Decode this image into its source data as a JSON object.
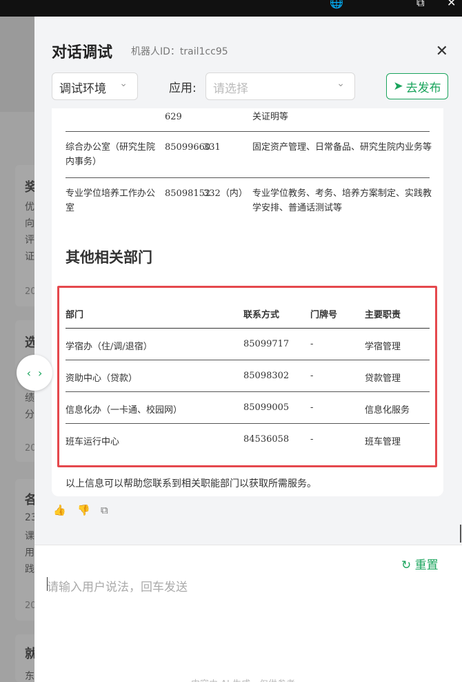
{
  "topbar": {
    "globe_icon": "globe-icon",
    "window_icon": "external-window-icon",
    "close_icon": "close-icon"
  },
  "background": {
    "cards": [
      {
        "title": "奖",
        "lines": [
          "优",
          "向",
          "评",
          "证"
        ],
        "date": "20"
      },
      {
        "title": "选",
        "lines": [
          "绩",
          "分"
        ],
        "date": "20"
      },
      {
        "title": "各",
        "lines": [
          "23",
          "课",
          "用",
          "践"
        ],
        "date": "20"
      },
      {
        "title": "就",
        "lines": [
          "东"
        ],
        "date": ""
      }
    ],
    "nav": {
      "prev": "‹",
      "next": "›"
    }
  },
  "header": {
    "title": "对话调试",
    "bot_id": "机器人ID：trail1cc95",
    "env_select": "调试环境",
    "app_label": "应用:",
    "app_placeholder": "请选择",
    "publish_label": "去发布",
    "accent": "#1aa45c"
  },
  "prev_table": {
    "rows": [
      {
        "dept": "",
        "phone": "629",
        "room": "",
        "duty": "关证明等"
      },
      {
        "dept": "综合办公室（研究生院内事务）",
        "phone": "85099660",
        "room": "331",
        "duty": "固定资产管理、日常备品、研究生院内业务等"
      },
      {
        "dept": "专业学位培养工作办公室",
        "phone": "85098152",
        "room": "332（内）",
        "duty": "专业学位教务、考务、培养方案制定、实践教学安排、普通话测试等"
      }
    ]
  },
  "section_title": "其他相关部门",
  "other_table": {
    "headers": [
      "部门",
      "联系方式",
      "门牌号",
      "主要职责"
    ],
    "rows": [
      [
        "学宿办（住/调/退宿）",
        "85099717",
        "-",
        "学宿管理"
      ],
      [
        "资助中心（贷款）",
        "85098302",
        "-",
        "贷款管理"
      ],
      [
        "信息化办（一卡通、校园网）",
        "85099005",
        "-",
        "信息化服务"
      ],
      [
        "班车运行中心",
        "84536058",
        "-",
        "班车管理"
      ]
    ]
  },
  "summary": "以上信息可以帮助您联系到相关职能部门以获取所需服务。",
  "input": {
    "reset_label": "重置",
    "placeholder": "请输入用户说法，回车发送",
    "footer": "内容由 AI 生成，仅供参考"
  }
}
